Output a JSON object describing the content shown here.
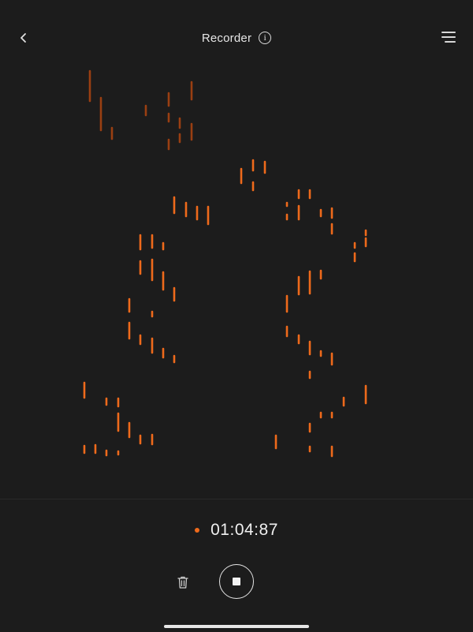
{
  "header": {
    "title": "Recorder",
    "back_icon": "chevron-left-icon",
    "info_icon": "info-icon",
    "info_glyph": "i",
    "menu_icon": "menu-icon"
  },
  "recording": {
    "elapsed": "01:04:87",
    "status_icon": "recording-dot-icon"
  },
  "controls": {
    "delete_icon": "trash-icon",
    "stop_icon": "stop-icon"
  },
  "colors": {
    "background": "#1c1c1c",
    "accent": "#ef6a1b",
    "accent_faded": "#9a3f12",
    "text": "#f0f0f0"
  }
}
